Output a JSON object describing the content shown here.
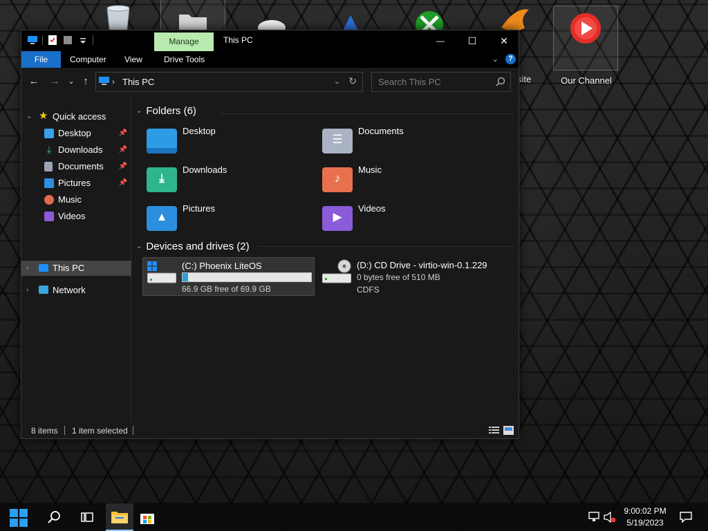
{
  "desktop": {
    "icons": [
      {
        "label": ""
      },
      {
        "label": ""
      },
      {
        "label": ""
      },
      {
        "label": ""
      },
      {
        "label": ""
      },
      {
        "label": "site"
      },
      {
        "label": "Our Channel"
      }
    ]
  },
  "window": {
    "title": "This PC",
    "manage_tab": "Manage",
    "controls": {
      "minimize": "—",
      "maximize": "☐",
      "close": "✕"
    },
    "ribbon_tabs": [
      "File",
      "Computer",
      "View",
      "Drive Tools"
    ],
    "help": "?",
    "address": {
      "path": "This PC"
    },
    "search": {
      "placeholder": "Search This PC"
    },
    "sidebar": {
      "quick_access": "Quick access",
      "items": [
        {
          "label": "Desktop",
          "icon": "desktop-icon",
          "color": "#3aa0e8"
        },
        {
          "label": "Downloads",
          "icon": "downloads-icon",
          "color": "#3bbf9a"
        },
        {
          "label": "Documents",
          "icon": "documents-icon",
          "color": "#9aa4b5"
        },
        {
          "label": "Pictures",
          "icon": "pictures-icon",
          "color": "#2f8fe0"
        },
        {
          "label": "Music",
          "icon": "music-icon",
          "color": "#e46a4a"
        },
        {
          "label": "Videos",
          "icon": "videos-icon",
          "color": "#8a5ad8"
        }
      ],
      "this_pc": "This PC",
      "network": "Network"
    },
    "folders": {
      "header": "Folders (6)",
      "items": [
        {
          "name": "Desktop",
          "color": "#2e9be6",
          "symbol": ""
        },
        {
          "name": "Documents",
          "color": "#a9b3c3",
          "symbol": "☰"
        },
        {
          "name": "Downloads",
          "color": "#2fb58e",
          "symbol": "⤓"
        },
        {
          "name": "Music",
          "color": "#e8704f",
          "symbol": "♪"
        },
        {
          "name": "Pictures",
          "color": "#2c8ede",
          "symbol": "▲"
        },
        {
          "name": "Videos",
          "color": "#8b5bd9",
          "symbol": "▶"
        }
      ]
    },
    "drives": {
      "header": "Devices and drives (2)",
      "items": [
        {
          "name": "(C:) Phoenix LiteOS",
          "free_text": "66.9 GB free of 69.9 GB",
          "used_fraction": 0.043
        },
        {
          "name": "(D:) CD Drive - virtio-win-0.1.229",
          "free_text": "0 bytes free of 510 MB",
          "fs": "CDFS"
        }
      ]
    },
    "status": {
      "items": "8 items",
      "selected": "1 item selected"
    }
  },
  "taskbar": {
    "time": "9:00:02 PM",
    "date": "5/19/2023"
  }
}
